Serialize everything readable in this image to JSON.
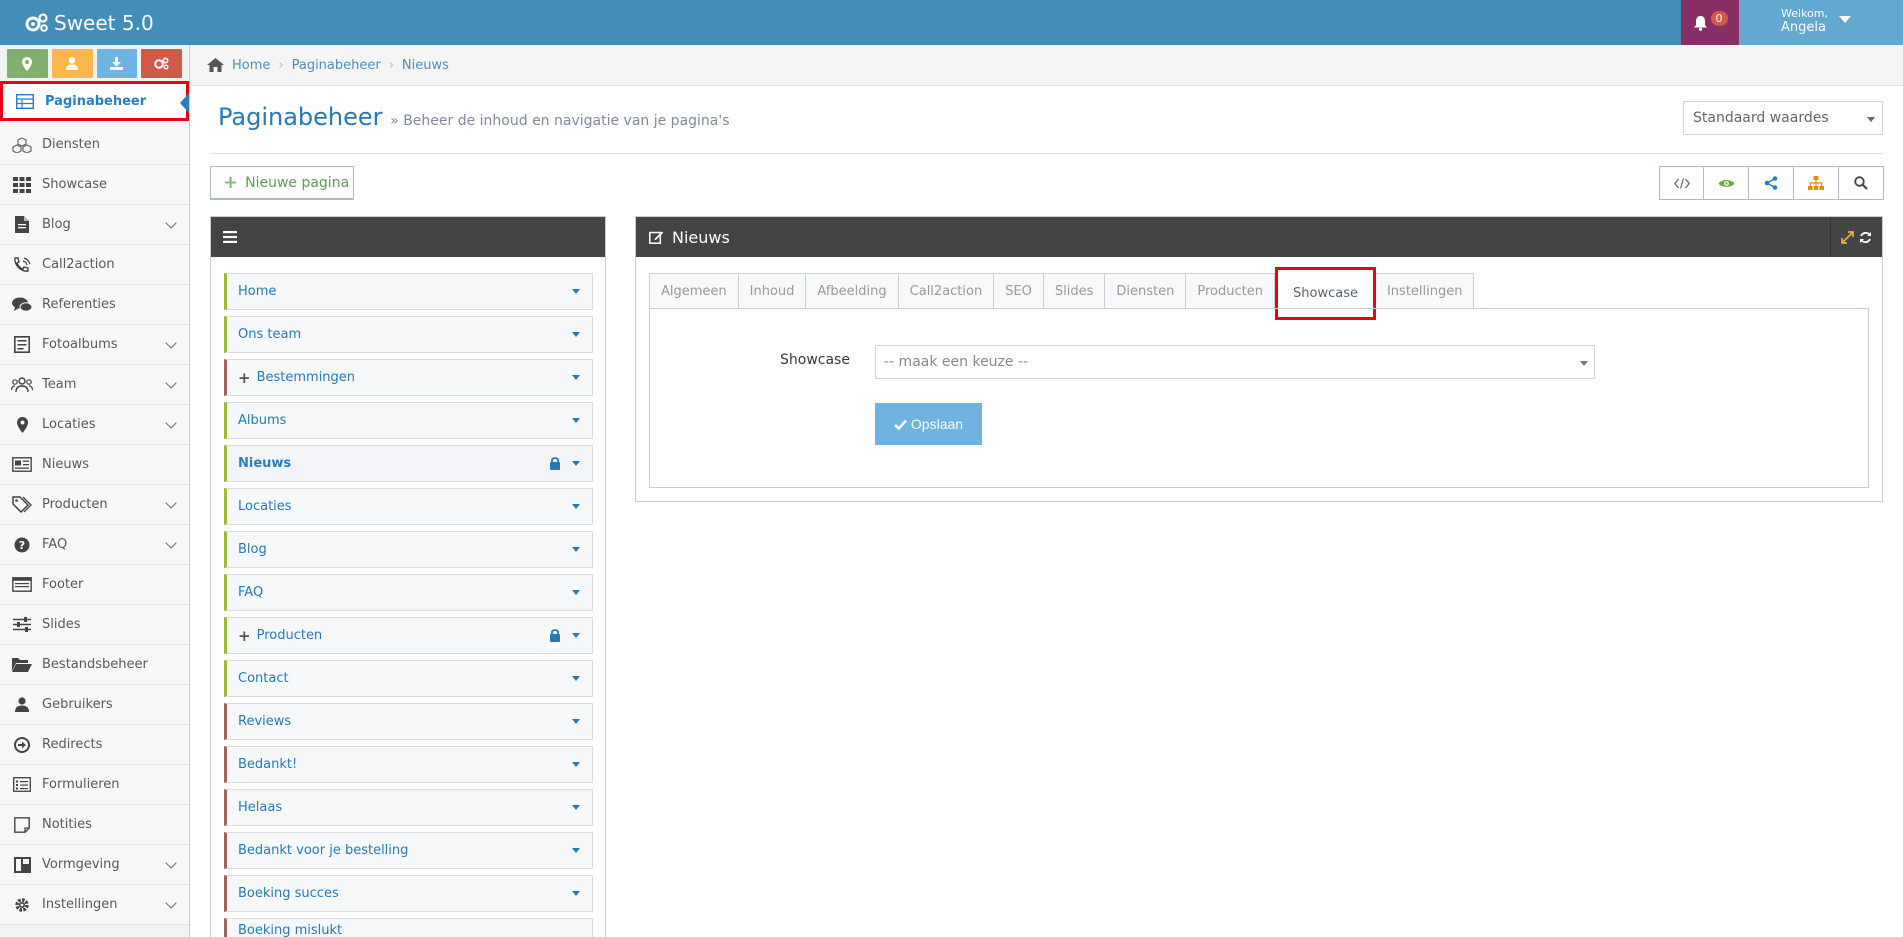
{
  "app": {
    "title": "Sweet 5.0"
  },
  "header": {
    "notifications_count": "0",
    "welcome": "Welkom,",
    "user_name": "Angela"
  },
  "sidebar": {
    "shortcuts": [
      "map-marker-icon",
      "user-icon",
      "download-icon",
      "cogs-icon"
    ],
    "items": [
      {
        "label": "Paginabeheer",
        "icon": "table-icon",
        "has_children": false,
        "active": true
      },
      {
        "label": "Diensten",
        "icon": "cubes-icon",
        "has_children": false
      },
      {
        "label": "Showcase",
        "icon": "grid-icon",
        "has_children": false
      },
      {
        "label": "Blog",
        "icon": "file-icon",
        "has_children": true
      },
      {
        "label": "Call2action",
        "icon": "phone-volume-icon",
        "has_children": false
      },
      {
        "label": "Referenties",
        "icon": "comments-icon",
        "has_children": false
      },
      {
        "label": "Fotoalbums",
        "icon": "album-icon",
        "has_children": true
      },
      {
        "label": "Team",
        "icon": "users-icon",
        "has_children": true
      },
      {
        "label": "Locaties",
        "icon": "map-marker-icon",
        "has_children": true
      },
      {
        "label": "Nieuws",
        "icon": "newspaper-icon",
        "has_children": false
      },
      {
        "label": "Producten",
        "icon": "tags-icon",
        "has_children": true
      },
      {
        "label": "FAQ",
        "icon": "question-icon",
        "has_children": true
      },
      {
        "label": "Footer",
        "icon": "footer-icon",
        "has_children": false
      },
      {
        "label": "Slides",
        "icon": "sliders-icon",
        "has_children": false
      },
      {
        "label": "Bestandsbeheer",
        "icon": "folder-open-icon",
        "has_children": false
      },
      {
        "label": "Gebruikers",
        "icon": "user-icon",
        "has_children": false
      },
      {
        "label": "Redirects",
        "icon": "arrow-circle-icon",
        "has_children": false
      },
      {
        "label": "Formulieren",
        "icon": "form-icon",
        "has_children": false
      },
      {
        "label": "Notities",
        "icon": "note-icon",
        "has_children": false
      },
      {
        "label": "Vormgeving",
        "icon": "layout-icon",
        "has_children": true
      },
      {
        "label": "Instellingen",
        "icon": "gear-icon",
        "has_children": true
      }
    ]
  },
  "breadcrumb": [
    "Home",
    "Paginabeheer",
    "Nieuws"
  ],
  "page": {
    "title": "Paginabeheer",
    "subtitle": "» Beheer de inhoud en navigatie van je pagina's",
    "default_select": "Standaard waardes",
    "new_page_label": "Nieuwe pagina",
    "toolbar": [
      "code-icon",
      "eye-icon",
      "share-icon",
      "sitemap-icon",
      "search-icon"
    ]
  },
  "tree": {
    "items": [
      {
        "label": "Home",
        "edge": "green"
      },
      {
        "label": "Ons team",
        "edge": "green"
      },
      {
        "label": "Bestemmingen",
        "edge": "red",
        "expandable": true
      },
      {
        "label": "Albums",
        "edge": "green"
      },
      {
        "label": "Nieuws",
        "edge": "green",
        "locked": true,
        "selected": true
      },
      {
        "label": "Locaties",
        "edge": "green"
      },
      {
        "label": "Blog",
        "edge": "green"
      },
      {
        "label": "FAQ",
        "edge": "green"
      },
      {
        "label": "Producten",
        "edge": "green",
        "expandable": true,
        "locked": true
      },
      {
        "label": "Contact",
        "edge": "green"
      },
      {
        "label": "Reviews",
        "edge": "red"
      },
      {
        "label": "Bedankt!",
        "edge": "red"
      },
      {
        "label": "Helaas",
        "edge": "red"
      },
      {
        "label": "Bedankt voor je bestelling",
        "edge": "red"
      },
      {
        "label": "Boeking succes",
        "edge": "red"
      },
      {
        "label": "Boeking mislukt",
        "edge": "red"
      }
    ]
  },
  "editor": {
    "title": "Nieuws",
    "tabs": [
      "Algemeen",
      "Inhoud",
      "Afbeelding",
      "Call2action",
      "SEO",
      "Slides",
      "Diensten",
      "Producten",
      "Showcase",
      "Instellingen"
    ],
    "active_tab": "Showcase",
    "field_label": "Showcase",
    "select_placeholder": "-- maak een keuze --",
    "save_label": "Opslaan"
  }
}
